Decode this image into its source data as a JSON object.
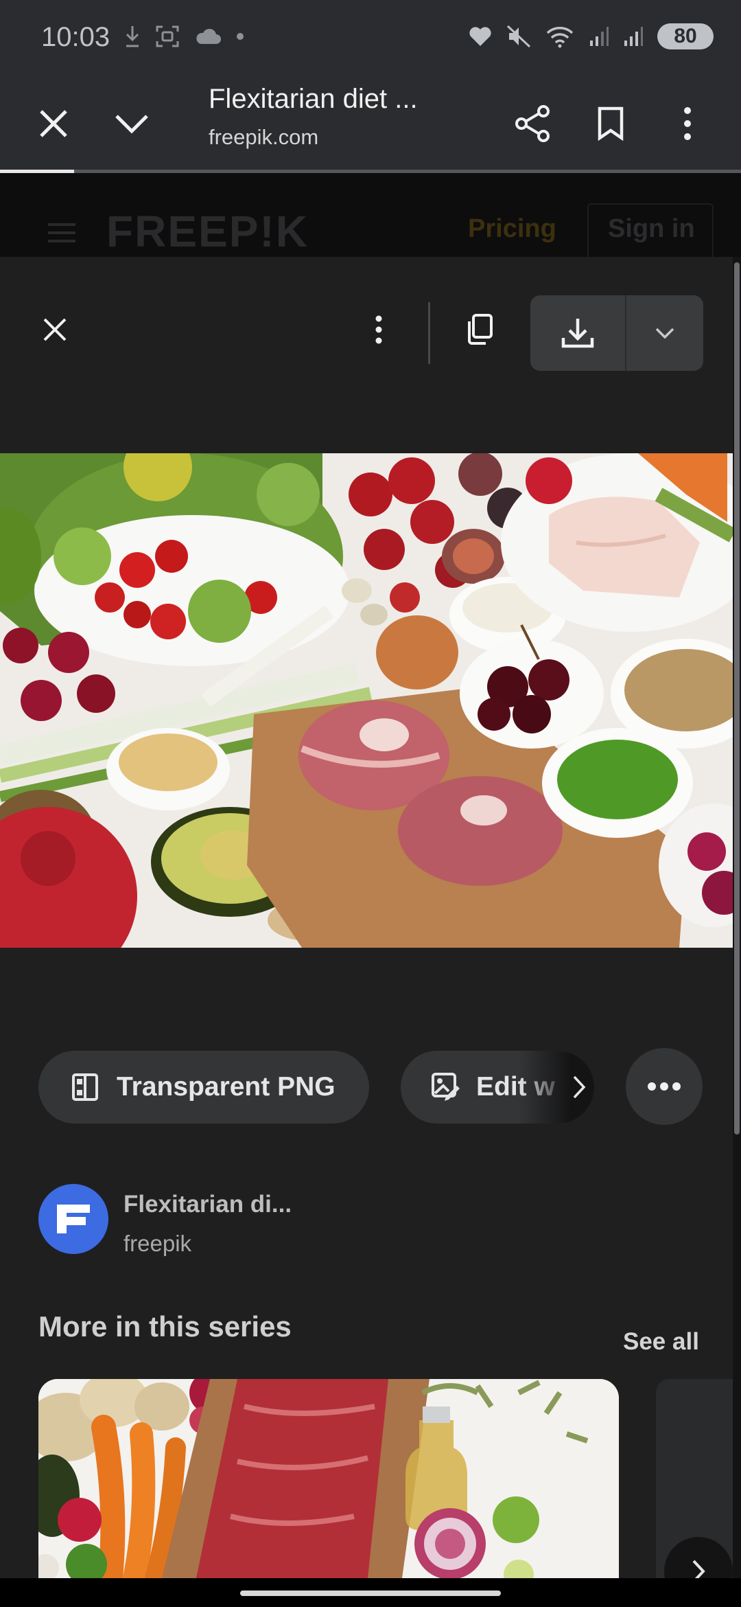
{
  "status_bar": {
    "time": "10:03",
    "battery": "80",
    "icons_left": [
      "download-icon",
      "screenshot-icon",
      "cloud-icon",
      "dot-icon"
    ],
    "icons_right": [
      "heart-icon",
      "mute-icon",
      "wifi-icon",
      "signal-icon",
      "signal-icon-2"
    ]
  },
  "toolbar": {
    "title": "Flexitarian diet ...",
    "url": "freepik.com",
    "load_progress": 0.1
  },
  "web_header": {
    "logo": "FREEP!K",
    "pricing": "Pricing",
    "sign_in": "Sign in"
  },
  "viewer": {
    "actions": {
      "transparent_png": "Transparent PNG",
      "edit": "Edit w"
    },
    "attribution": {
      "title": "Flexitarian di...",
      "author": "freepik"
    },
    "series": {
      "title": "More in this series",
      "see_all": "See all"
    }
  },
  "colors": {
    "background": "#1f1f20",
    "toolbar": "#2b2c2f",
    "avatar": "#3d6be1",
    "chip": "#343537"
  }
}
